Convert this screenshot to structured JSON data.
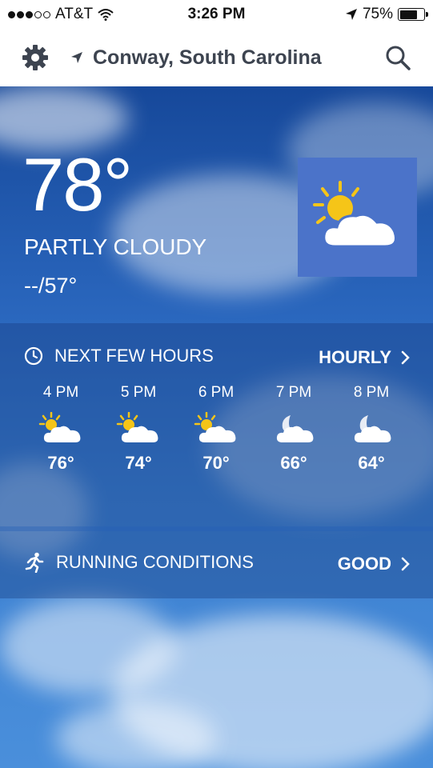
{
  "status_bar": {
    "carrier": "AT&T",
    "time": "3:26 PM",
    "battery": "75%",
    "battery_level": 0.75,
    "signal_bars_filled": 3,
    "signal_bars_total": 5
  },
  "header": {
    "location": "Conway, South Carolina",
    "icons": [
      "gear-icon",
      "location-arrow-icon",
      "search-icon"
    ]
  },
  "current": {
    "temperature": "78°",
    "condition": "PARTLY CLOUDY",
    "hilo": "--/57°",
    "icon": "partly-cloudy-day-icon"
  },
  "hourly": {
    "title": "NEXT FEW HOURS",
    "link_label": "HOURLY",
    "items": [
      {
        "time": "4 PM",
        "temp": "76°",
        "icon": "partly-cloudy-day-icon"
      },
      {
        "time": "5 PM",
        "temp": "74°",
        "icon": "partly-cloudy-day-icon"
      },
      {
        "time": "6 PM",
        "temp": "70°",
        "icon": "partly-cloudy-day-icon"
      },
      {
        "time": "7 PM",
        "temp": "66°",
        "icon": "partly-cloudy-night-icon"
      },
      {
        "time": "8 PM",
        "temp": "64°",
        "icon": "partly-cloudy-night-icon"
      }
    ]
  },
  "running": {
    "title": "RUNNING CONDITIONS",
    "value": "GOOD"
  },
  "colors": {
    "header_text": "#3d4450",
    "sun": "#f5c518",
    "icon_box": "#4b73c9"
  }
}
